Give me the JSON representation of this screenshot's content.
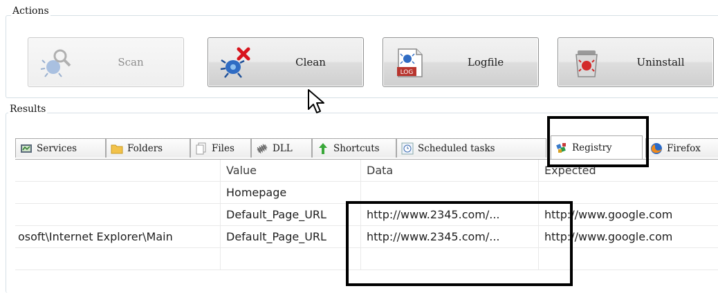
{
  "actions": {
    "title": "Actions",
    "buttons": [
      {
        "label": "Scan",
        "icon": "scan-bug-magnifier-icon",
        "enabled": false
      },
      {
        "label": "Clean",
        "icon": "clean-bug-x-icon",
        "enabled": true
      },
      {
        "label": "Logfile",
        "icon": "logfile-icon",
        "enabled": true
      },
      {
        "label": "Uninstall",
        "icon": "uninstall-bin-icon",
        "enabled": true
      }
    ]
  },
  "results": {
    "title": "Results",
    "tabs": [
      {
        "label": "Services",
        "icon": "services-icon"
      },
      {
        "label": "Folders",
        "icon": "folder-icon"
      },
      {
        "label": "Files",
        "icon": "files-icon"
      },
      {
        "label": "DLL",
        "icon": "dll-icon"
      },
      {
        "label": "Shortcuts",
        "icon": "shortcut-arrow-icon"
      },
      {
        "label": "Scheduled tasks",
        "icon": "scheduled-tasks-icon"
      },
      {
        "label": "Registry",
        "icon": "registry-icon",
        "active": true
      },
      {
        "label": "Firefox",
        "icon": "firefox-icon"
      }
    ],
    "grid": {
      "columns": [
        "",
        "Value",
        "Data",
        "Expected"
      ],
      "rows": [
        [
          "",
          "Homepage",
          "",
          ""
        ],
        [
          "",
          "Default_Page_URL",
          "http://www.2345.com/...",
          "http://www.google.com"
        ],
        [
          "osoft\\Internet Explorer\\Main",
          "Default_Page_URL",
          "http://www.2345.com/...",
          "http://www.google.com"
        ],
        [
          "",
          "",
          "",
          ""
        ]
      ]
    }
  },
  "colors": {
    "highlight_border": "#000000",
    "button_border": "#8e8f8f",
    "tab_border": "#a9a9a9"
  }
}
